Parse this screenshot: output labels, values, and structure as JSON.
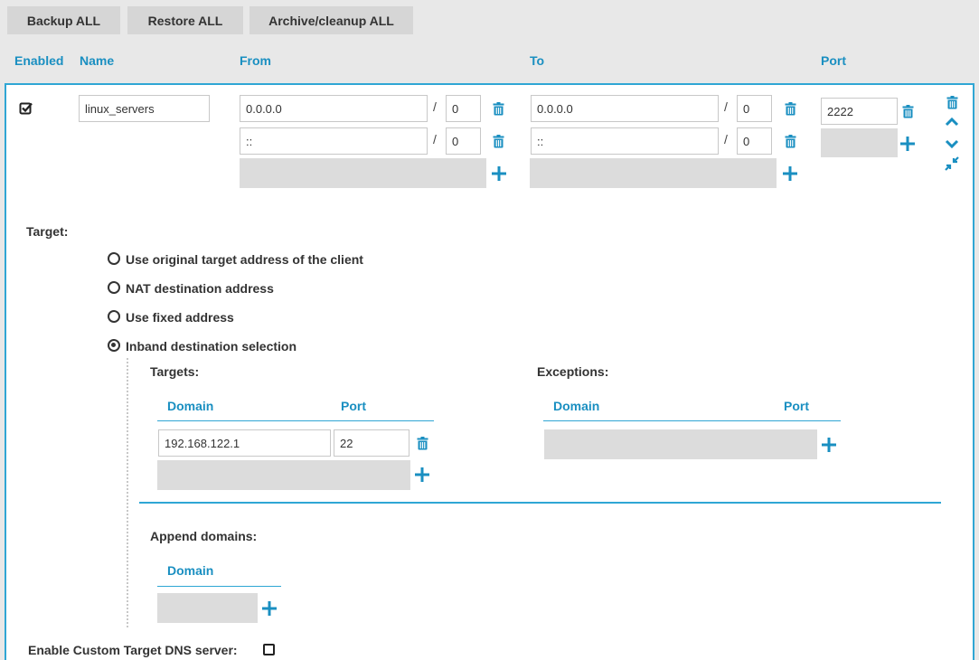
{
  "toolbar": {
    "backup_label": "Backup ALL",
    "restore_label": "Restore ALL",
    "archive_label": "Archive/cleanup ALL"
  },
  "columns": {
    "enabled": "Enabled",
    "name": "Name",
    "from": "From",
    "to": "To",
    "port": "Port"
  },
  "rule": {
    "enabled": true,
    "name": "linux_servers",
    "from": [
      {
        "address": "0.0.0.0",
        "mask": "0"
      },
      {
        "address": "::",
        "mask": "0"
      }
    ],
    "to": [
      {
        "address": "0.0.0.0",
        "mask": "0"
      },
      {
        "address": "::",
        "mask": "0"
      }
    ],
    "ports": [
      "2222"
    ],
    "slash": "/"
  },
  "target": {
    "label": "Target:",
    "options": [
      {
        "label": "Use original target address of the client",
        "selected": false
      },
      {
        "label": "NAT destination address",
        "selected": false
      },
      {
        "label": "Use fixed address",
        "selected": false
      },
      {
        "label": "Inband destination selection",
        "selected": true
      }
    ]
  },
  "inband": {
    "targets_label": "Targets:",
    "exceptions_label": "Exceptions:",
    "domain_col": "Domain",
    "port_col": "Port",
    "targets": [
      {
        "domain": "192.168.122.1",
        "port": "22"
      }
    ],
    "append_label": "Append domains:"
  },
  "dns": {
    "label": "Enable Custom Target DNS server:",
    "checked": false
  },
  "icons": {
    "delete": "trash-icon",
    "add": "plus-icon",
    "up": "chevron-up-icon",
    "down": "chevron-down-icon",
    "collapse": "collapse-icon",
    "checkbox": "checkbox-icon"
  },
  "colors": {
    "accent": "#1a8fc1",
    "border": "#2fa6d4",
    "button_bg": "#d6d6d6",
    "empty_field": "#dcdcdc"
  }
}
